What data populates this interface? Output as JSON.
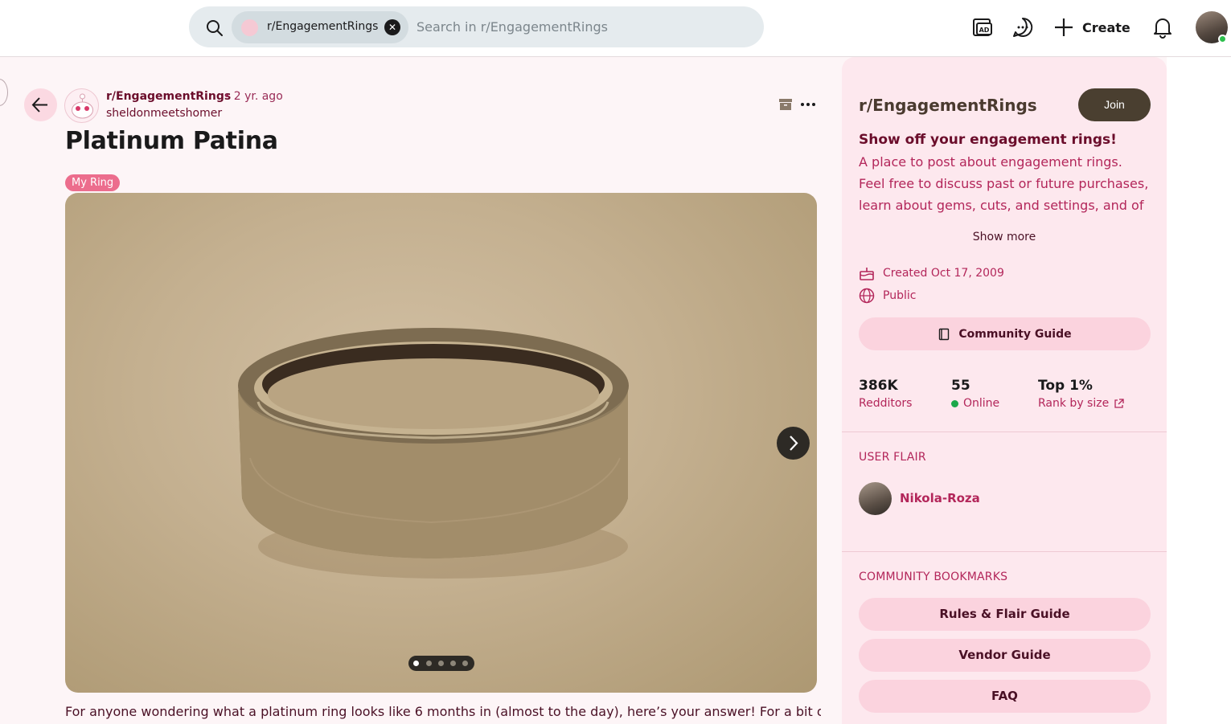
{
  "topbar": {
    "search_chip_label": "r/EngagementRings",
    "search_placeholder": "Search in r/EngagementRings",
    "create_label": "Create",
    "icons": [
      "search-icon",
      "advertise-icon",
      "chat-icon",
      "plus-icon",
      "bell-icon"
    ]
  },
  "post": {
    "subreddit": "r/EngagementRings",
    "time": "• 2 yr. ago",
    "author": "sheldonmeetshomer",
    "title": "Platinum Patina",
    "flair": "My Ring",
    "gallery": {
      "count": 5,
      "current": 1
    },
    "body_preview": "For anyone wondering what a platinum ring looks like 6 months in (almost to the day), here’s your answer! For a bit of"
  },
  "sidebar": {
    "title": "r/EngagementRings",
    "join_label": "Join",
    "tagline": "Show off your engagement rings!",
    "description": "A place to post about engagement rings. Feel free to discuss past or future purchases, learn about gems, cuts, and settings, and of cour…",
    "show_more": "Show more",
    "created": "Created Oct 17, 2009",
    "visibility": "Public",
    "community_guide": "Community Guide",
    "stats": [
      {
        "value": "386K",
        "label": "Redditors"
      },
      {
        "value": "55",
        "label": "Online"
      },
      {
        "value": "Top 1%",
        "label": "Rank by size"
      }
    ],
    "user_flair_heading": "USER FLAIR",
    "user_flair_name": "Nikola-Roza",
    "bookmarks_heading": "COMMUNITY BOOKMARKS",
    "bookmarks": [
      "Rules & Flair Guide",
      "Vendor Guide",
      "FAQ"
    ]
  },
  "colors": {
    "accent": "#b3265a",
    "dark_text": "#6b0d2b",
    "join_button": "#4a3f30",
    "flair_bg": "#ec6d8d",
    "sidebar_bg": "#fde8ee"
  }
}
